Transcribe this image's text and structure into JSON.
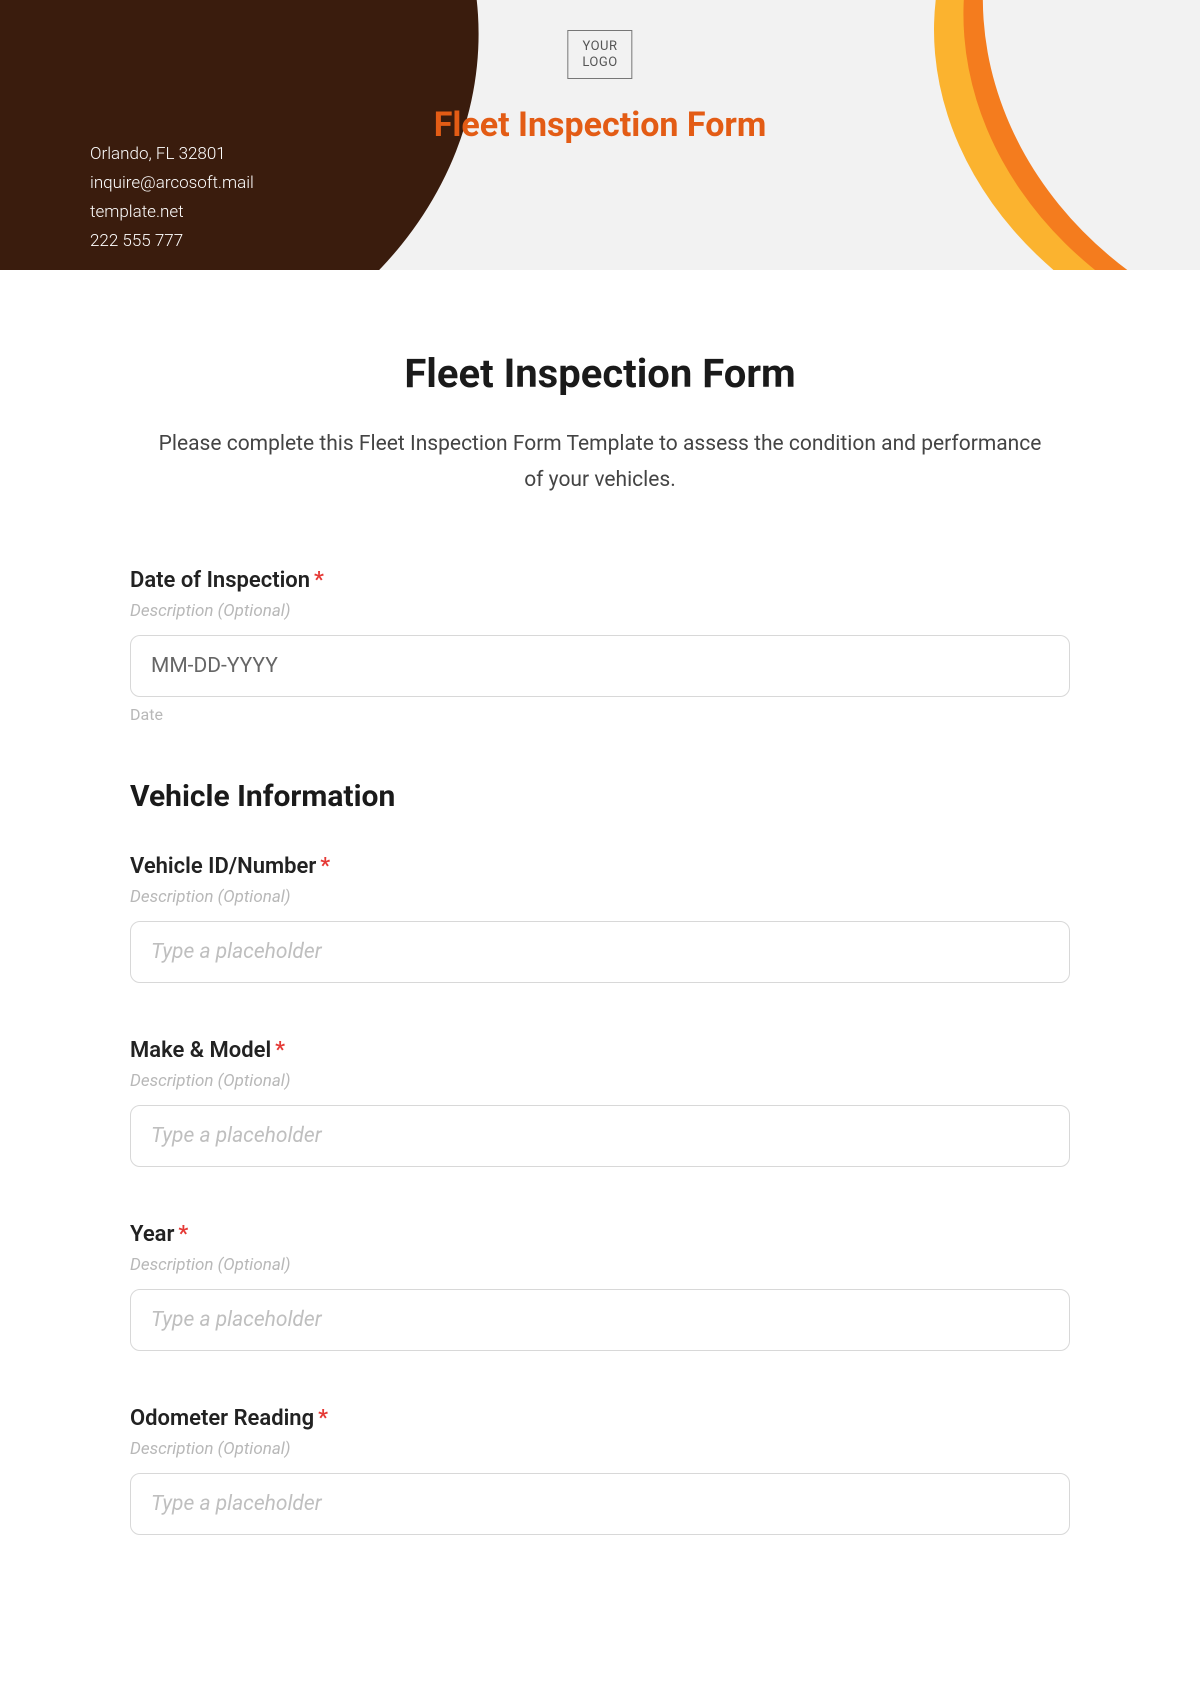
{
  "header": {
    "logo_line1": "YOUR",
    "logo_line2": "LOGO",
    "title": "Fleet Inspection Form",
    "contact": {
      "address": "Orlando, FL 32801",
      "email": "inquire@arcosoft.mail",
      "website": "template.net",
      "phone": "222 555 777"
    }
  },
  "form": {
    "title": "Fleet Inspection Form",
    "description": "Please complete this Fleet Inspection Form Template to assess the condition and performance of your vehicles.",
    "desc_placeholder": "Description (Optional)",
    "fields": {
      "date": {
        "label": "Date of Inspection",
        "placeholder": "MM-DD-YYYY",
        "sublabel": "Date"
      },
      "section_vehicle": "Vehicle Information",
      "vehicle_id": {
        "label": "Vehicle ID/Number",
        "placeholder": "Type a placeholder"
      },
      "make_model": {
        "label": "Make & Model",
        "placeholder": "Type a placeholder"
      },
      "year": {
        "label": "Year",
        "placeholder": "Type a placeholder"
      },
      "odometer": {
        "label": "Odometer Reading",
        "placeholder": "Type a placeholder"
      }
    }
  }
}
